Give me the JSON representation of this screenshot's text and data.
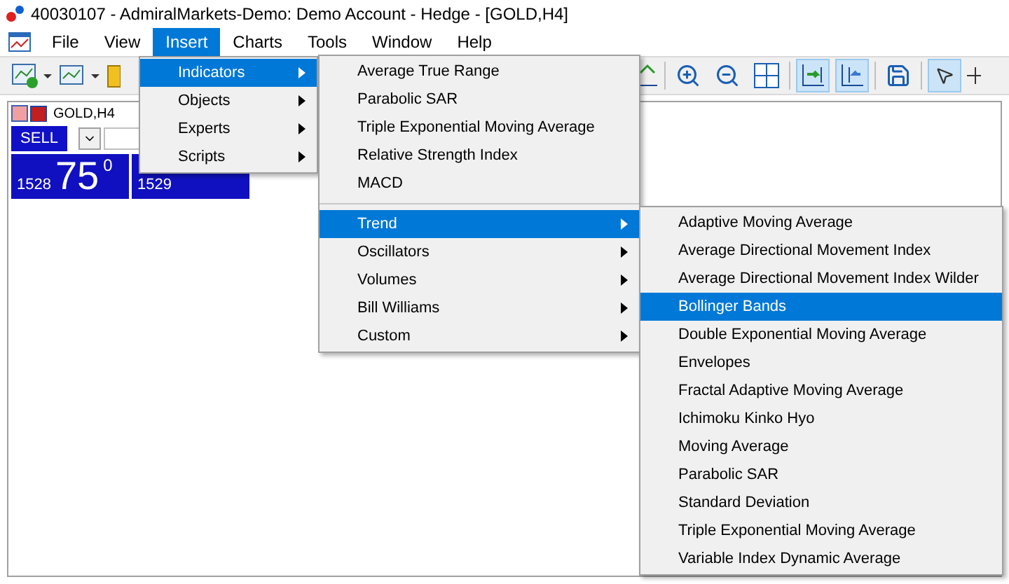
{
  "window": {
    "title": "40030107 - AdmiralMarkets-Demo: Demo Account - Hedge - [GOLD,H4]"
  },
  "menu_bar": [
    {
      "label": "File",
      "selected": false
    },
    {
      "label": "View",
      "selected": false
    },
    {
      "label": "Insert",
      "selected": true
    },
    {
      "label": "Charts",
      "selected": false
    },
    {
      "label": "Tools",
      "selected": false
    },
    {
      "label": "Window",
      "selected": false
    },
    {
      "label": "Help",
      "selected": false
    }
  ],
  "chart_window": {
    "title": "GOLD,H4",
    "sell_button": "SELL",
    "bid": {
      "small": "1528",
      "big": "75",
      "sup": "0"
    },
    "ask": {
      "small": "1529"
    }
  },
  "insert_menu": [
    {
      "label": "Indicators",
      "submenu": true,
      "selected": true
    },
    {
      "label": "Objects",
      "submenu": true,
      "selected": false
    },
    {
      "label": "Experts",
      "submenu": true,
      "selected": false
    },
    {
      "label": "Scripts",
      "submenu": true,
      "selected": false
    }
  ],
  "indicators_menu": [
    {
      "kind": "item",
      "label": "Average True Range",
      "submenu": false,
      "selected": false
    },
    {
      "kind": "item",
      "label": "Parabolic SAR",
      "submenu": false,
      "selected": false
    },
    {
      "kind": "item",
      "label": "Triple Exponential Moving Average",
      "submenu": false,
      "selected": false
    },
    {
      "kind": "item",
      "label": "Relative Strength Index",
      "submenu": false,
      "selected": false
    },
    {
      "kind": "item",
      "label": "MACD",
      "submenu": false,
      "selected": false
    },
    {
      "kind": "separator"
    },
    {
      "kind": "item",
      "label": "Trend",
      "submenu": true,
      "selected": true
    },
    {
      "kind": "item",
      "label": "Oscillators",
      "submenu": true,
      "selected": false
    },
    {
      "kind": "item",
      "label": "Volumes",
      "submenu": true,
      "selected": false
    },
    {
      "kind": "item",
      "label": "Bill Williams",
      "submenu": true,
      "selected": false
    },
    {
      "kind": "item",
      "label": "Custom",
      "submenu": true,
      "selected": false
    }
  ],
  "trend_menu": [
    {
      "label": "Adaptive Moving Average",
      "selected": false
    },
    {
      "label": "Average Directional Movement Index",
      "selected": false
    },
    {
      "label": "Average Directional Movement Index Wilder",
      "selected": false
    },
    {
      "label": "Bollinger Bands",
      "selected": true
    },
    {
      "label": "Double Exponential Moving Average",
      "selected": false
    },
    {
      "label": "Envelopes",
      "selected": false
    },
    {
      "label": "Fractal Adaptive Moving Average",
      "selected": false
    },
    {
      "label": "Ichimoku Kinko Hyo",
      "selected": false
    },
    {
      "label": "Moving Average",
      "selected": false
    },
    {
      "label": "Parabolic SAR",
      "selected": false
    },
    {
      "label": "Standard Deviation",
      "selected": false
    },
    {
      "label": "Triple Exponential Moving Average",
      "selected": false
    },
    {
      "label": "Variable Index Dynamic Average",
      "selected": false
    }
  ]
}
